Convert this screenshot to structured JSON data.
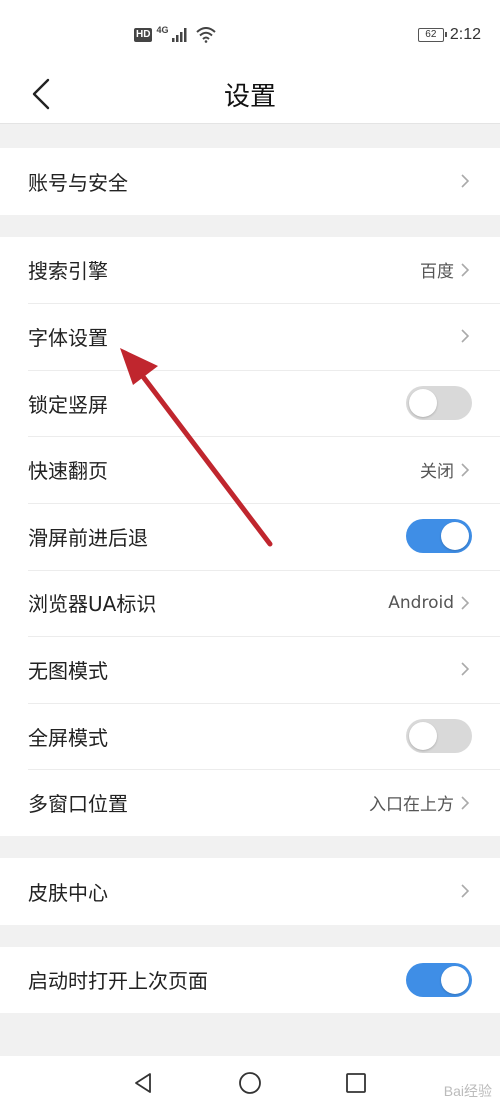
{
  "status_bar": {
    "hd": "HD",
    "network": "4G",
    "battery": "62",
    "time": "2:12"
  },
  "header": {
    "title": "设置"
  },
  "groups": [
    {
      "rows": [
        {
          "label": "账号与安全",
          "type": "link"
        }
      ]
    },
    {
      "rows": [
        {
          "label": "搜索引擎",
          "type": "value",
          "value": "百度"
        },
        {
          "label": "字体设置",
          "type": "link"
        },
        {
          "label": "锁定竖屏",
          "type": "toggle",
          "checked": false
        },
        {
          "label": "快速翻页",
          "type": "value",
          "value": "关闭"
        },
        {
          "label": "滑屏前进后退",
          "type": "toggle",
          "checked": true
        },
        {
          "label": "浏览器UA标识",
          "type": "value",
          "value": "Android"
        },
        {
          "label": "无图模式",
          "type": "link"
        },
        {
          "label": "全屏模式",
          "type": "toggle",
          "checked": false
        },
        {
          "label": "多窗口位置",
          "type": "value",
          "value": "入口在上方"
        }
      ]
    },
    {
      "rows": [
        {
          "label": "皮肤中心",
          "type": "link"
        }
      ]
    },
    {
      "rows": [
        {
          "label": "启动时打开上次页面",
          "type": "toggle",
          "checked": true
        }
      ]
    }
  ],
  "colors": {
    "toggle_on": "#3f8ee6",
    "toggle_off": "#d9d9d9",
    "annotation_arrow": "#c0262e"
  },
  "nav": {
    "back_icon": "triangle-back-icon",
    "home_icon": "circle-home-icon",
    "recents_icon": "square-recents-icon"
  },
  "watermark": "Bai经验"
}
